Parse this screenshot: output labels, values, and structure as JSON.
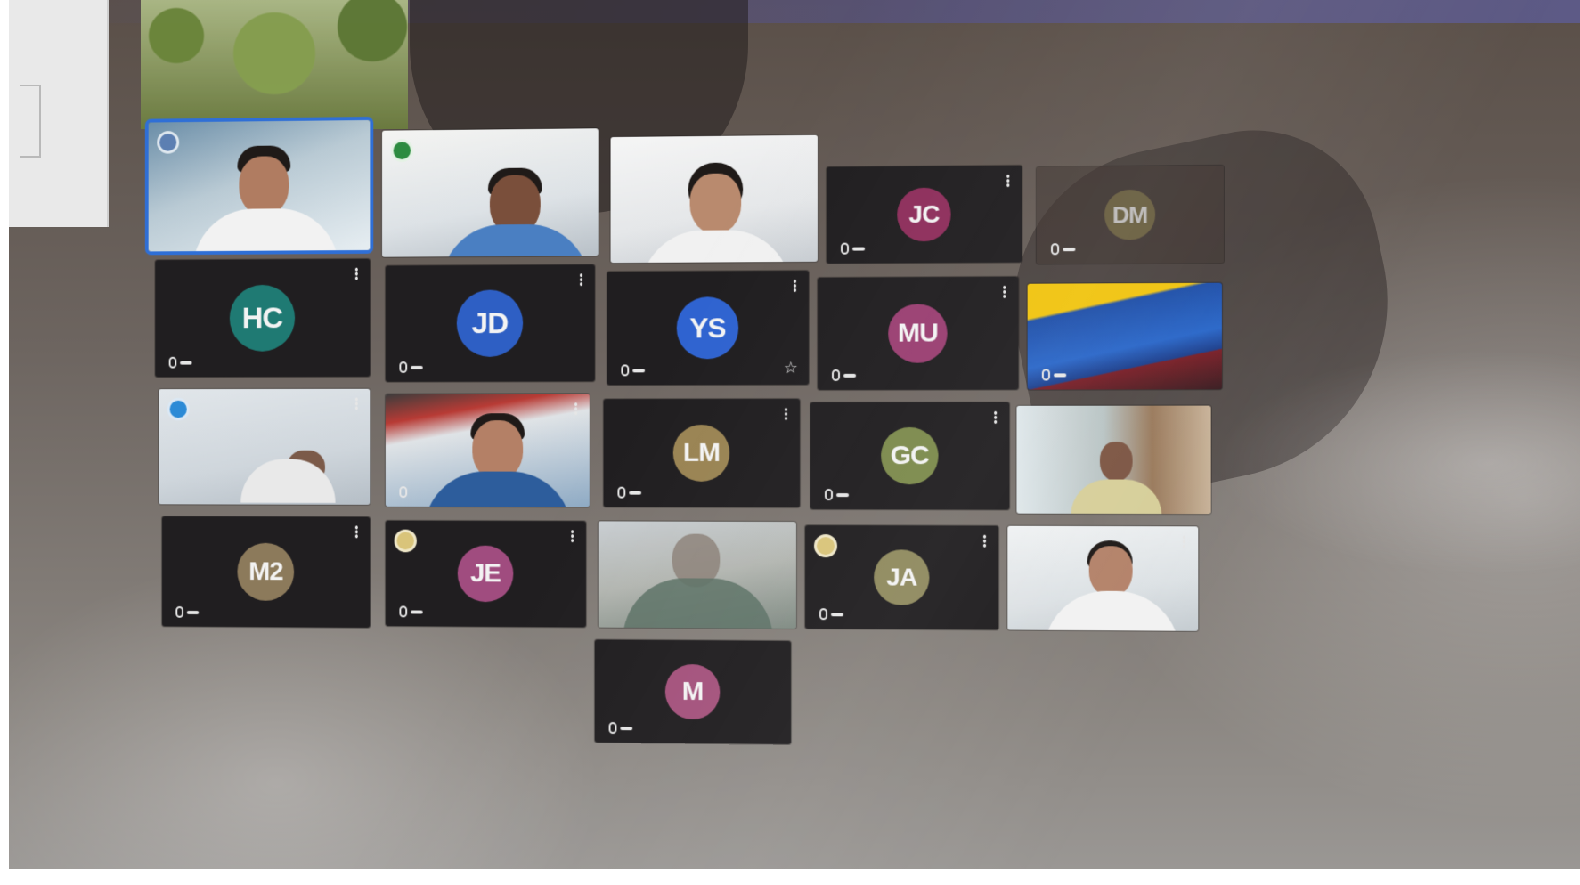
{
  "meeting": {
    "participants": [
      {
        "id": "p1",
        "type": "video",
        "active": true
      },
      {
        "id": "p2",
        "type": "video"
      },
      {
        "id": "p3",
        "type": "video"
      },
      {
        "id": "p4",
        "type": "avatar",
        "initials": "JC",
        "color": "#8e2f5c"
      },
      {
        "id": "p5",
        "type": "avatar",
        "initials": "DM",
        "color": "#7b7046"
      },
      {
        "id": "p6",
        "type": "avatar",
        "initials": "HC",
        "color": "#1f7a73"
      },
      {
        "id": "p7",
        "type": "avatar",
        "initials": "JD",
        "color": "#2e5fc4"
      },
      {
        "id": "p8",
        "type": "avatar",
        "initials": "YS",
        "color": "#2f63d0"
      },
      {
        "id": "p9",
        "type": "avatar",
        "initials": "MU",
        "color": "#9a3f72"
      },
      {
        "id": "p10",
        "type": "flag"
      },
      {
        "id": "p11",
        "type": "video"
      },
      {
        "id": "p12",
        "type": "video"
      },
      {
        "id": "p13",
        "type": "avatar",
        "initials": "LM",
        "color": "#9a8453"
      },
      {
        "id": "p14",
        "type": "avatar",
        "initials": "GC",
        "color": "#7c8a4c"
      },
      {
        "id": "p15",
        "type": "video"
      },
      {
        "id": "p16",
        "type": "avatar",
        "initials": "M2",
        "color": "#8c7a5b"
      },
      {
        "id": "p17",
        "type": "avatar",
        "initials": "JE",
        "color": "#a04c7f"
      },
      {
        "id": "p18",
        "type": "video"
      },
      {
        "id": "p19",
        "type": "avatar",
        "initials": "JA",
        "color": "#8f8a5e"
      },
      {
        "id": "p20",
        "type": "video"
      },
      {
        "id": "p21",
        "type": "avatar",
        "initials": "M",
        "color": "#a4527c"
      }
    ]
  },
  "colors": {
    "tile_background": "#201e20",
    "active_speaker_border": "#2f6fd6"
  },
  "icons": {
    "mic": "mic-icon",
    "menu": "more-options-icon",
    "star": "star-icon",
    "badge": "status-badge-icon"
  }
}
